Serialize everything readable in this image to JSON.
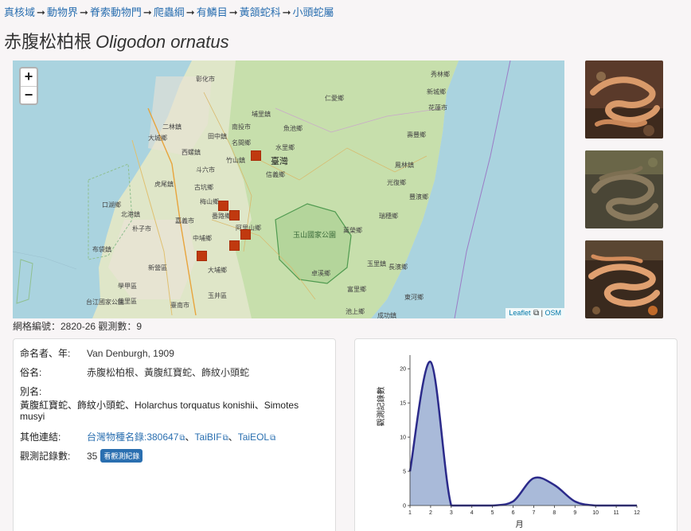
{
  "breadcrumb": [
    "真核域",
    "動物界",
    "脊索動物門",
    "爬蟲綱",
    "有鱗目",
    "黃頷蛇科",
    "小頭蛇屬"
  ],
  "species": {
    "common": "赤腹松柏根",
    "scientific": "Oligodon ornatus"
  },
  "map": {
    "zoom_in": "+",
    "zoom_out": "−",
    "attribution_leaflet": "Leaflet",
    "attribution_sep": "|",
    "attribution_osm": "OSM",
    "labels": [
      "彰化市",
      "南投市",
      "二林鎮",
      "田中鎮",
      "大城鄉",
      "西螺鎮",
      "竹山鎮",
      "名間鄉",
      "水里鄉",
      "魚池鄉",
      "臺灣",
      "信義鄉",
      "斗六市",
      "古坑鄉",
      "虎尾鎮",
      "梅山鄉",
      "嘉義市",
      "阿里山鄉",
      "中埔鄉",
      "玉山國家公園",
      "朴子市",
      "布袋鎮",
      "新營區",
      "學甲區",
      "佳里區",
      "台江國家公園",
      "玉井區",
      "仁愛鄉",
      "埔里鎮",
      "秀林鄉",
      "新城鄉",
      "花蓮市",
      "壽豐鄉",
      "鳳林鎮",
      "光復鄉",
      "豐濱鄉",
      "瑞穗鄉",
      "玉里鎮",
      "富里鄉",
      "池上鄉",
      "成功鎮",
      "長濱鄉",
      "卓溪鄉",
      "萬榮鄉",
      "東河鄉",
      "臺南市",
      "大埔鄉",
      "番路鄉",
      "口湖鄉",
      "北港鎮"
    ],
    "grid_cells_count": 6
  },
  "grid_info": "網格編號：2820-26 觀測數：9",
  "info": {
    "author_key": "命名者、年:",
    "author_val": "Van Denburgh, 1909",
    "common_key": "俗名:",
    "common_val": "赤腹松柏根、黃腹紅寶蛇、飾紋小頭蛇",
    "alias_key": "別名:",
    "alias_line1": "黃腹紅寶蛇、飾紋小頭蛇、Holarchus torquatus konishii、Simotes",
    "alias_line2": "musyi",
    "links_key": "其他連結:",
    "link1": "台灣物種名錄:380647",
    "link2": "TaiBIF",
    "link3": "TaiEOL",
    "link_sep": "、",
    "count_key": "觀測記錄數:",
    "count_val": "35",
    "count_button": "看觀測紀錄"
  },
  "chart_data": {
    "type": "area",
    "xlabel": "月",
    "ylabel": "觀測記錄數",
    "x": [
      1,
      2,
      3,
      4,
      5,
      6,
      7,
      8,
      9,
      10,
      11,
      12
    ],
    "xlim": [
      1,
      12
    ],
    "ylim": [
      0,
      22
    ],
    "yticks": [
      0,
      5,
      10,
      15,
      20
    ],
    "series": [
      {
        "values": [
          5,
          21,
          0,
          0,
          0,
          0.6,
          4,
          3,
          0.6,
          0,
          0,
          0
        ]
      }
    ],
    "colors": {
      "line": "#2b2a8a",
      "fill": "#a9bad9"
    }
  }
}
